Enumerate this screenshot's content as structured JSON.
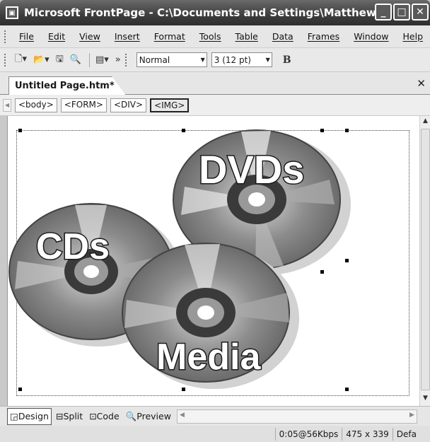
{
  "window": {
    "title": "Microsoft FrontPage - C:\\Documents and Settings\\Matthew\\Des...",
    "buttons": [
      "minimize",
      "restore",
      "close"
    ]
  },
  "menubar": [
    "File",
    "Edit",
    "View",
    "Insert",
    "Format",
    "Tools",
    "Table",
    "Data",
    "Frames",
    "Window",
    "Help"
  ],
  "toolbar": {
    "style_value": "Normal",
    "size_value": "3 (12 pt)",
    "bold_label": "B"
  },
  "document_tab": {
    "label": "Untitled Page.htm*"
  },
  "quick_tags": [
    "<body>",
    "<FORM>",
    "<DIV>",
    "<IMG>"
  ],
  "clipart": {
    "labels": [
      "DVDs",
      "CDs",
      "Media"
    ],
    "colors": {
      "disc": "#8a8a8a",
      "disc_light": "#c4c4c4",
      "hub": "#2e2e2e",
      "text_fill": "#ffffff",
      "text_stroke": "#1a1a1a"
    }
  },
  "view_tabs": [
    "Design",
    "Split",
    "Code",
    "Preview"
  ],
  "status": {
    "download_time": "0:05@56Kbps",
    "dimensions": "475 x 339",
    "mode": "Defa"
  }
}
